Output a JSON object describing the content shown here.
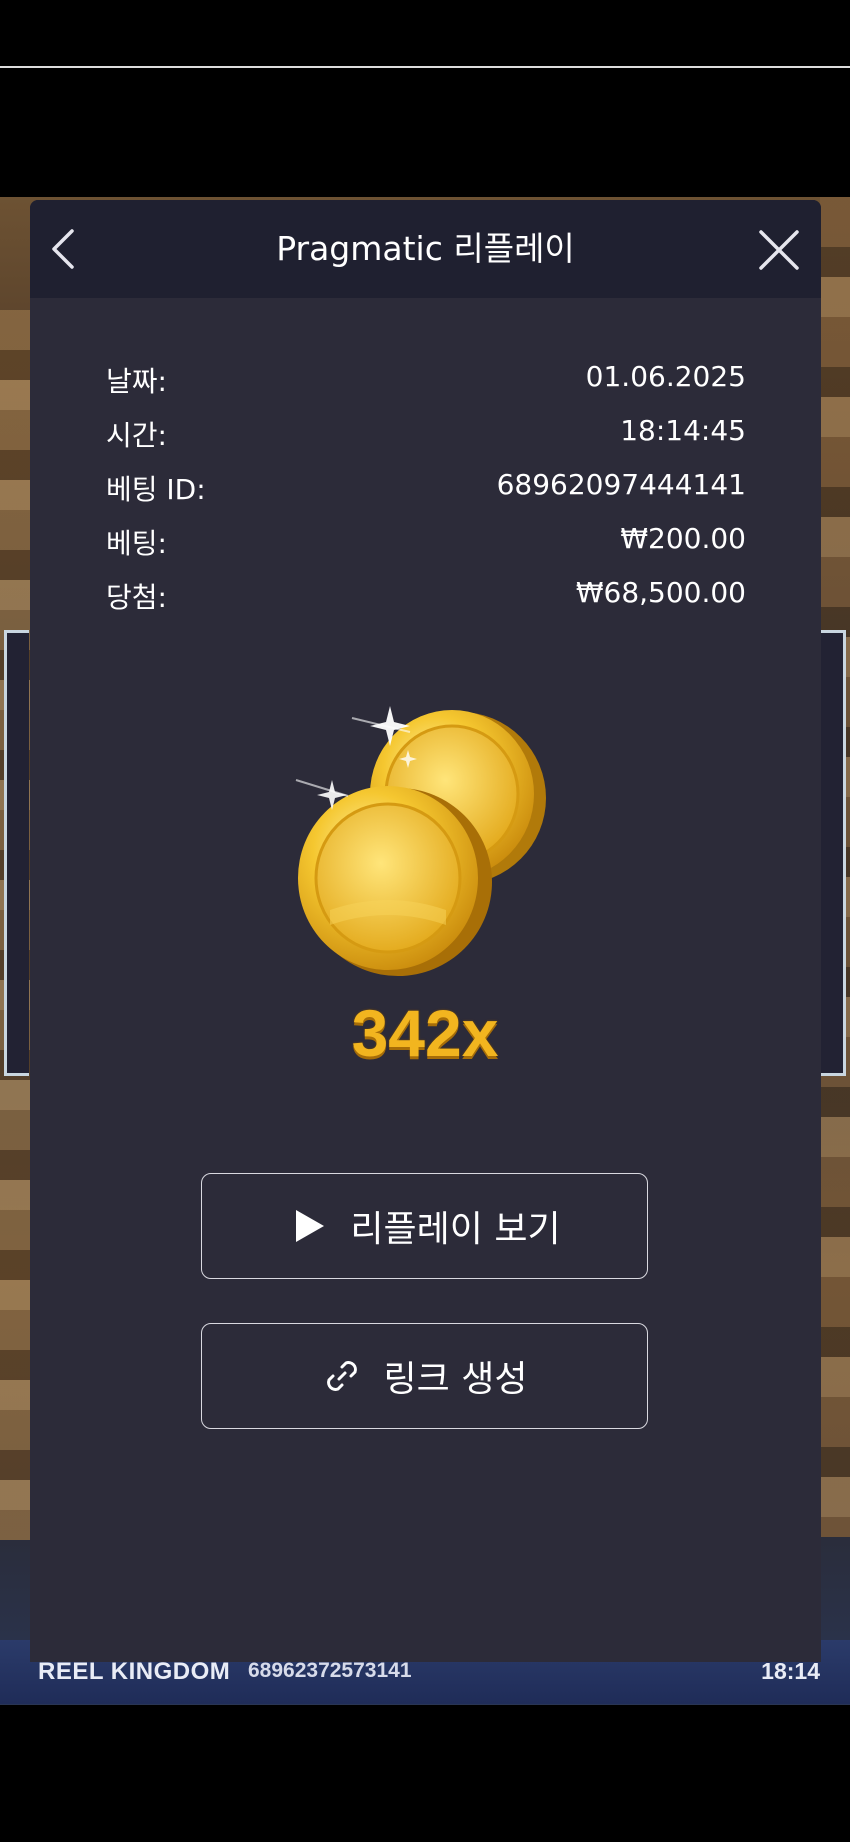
{
  "header": {
    "title": "Pragmatic 리플레이",
    "expand_glyph": "»"
  },
  "details": [
    {
      "label": "날짜:",
      "value": "01.06.2025"
    },
    {
      "label": "시간:",
      "value": "18:14:45"
    },
    {
      "label": "베팅 ID:",
      "value": "68962097444141"
    },
    {
      "label": "베팅:",
      "value": "₩200.00"
    },
    {
      "label": "당첨:",
      "value": "₩68,500.00"
    }
  ],
  "win": {
    "multiplier": "342x",
    "icon": "gold-coins-icon"
  },
  "actions": {
    "replay_label": "리플레이 보기",
    "link_label": "링크 생성"
  },
  "ticker": {
    "brand": "REEL KINGDOM",
    "bet_id": "68962372573141",
    "time": "18:14"
  },
  "colors": {
    "modal_bg": "#2c2b39",
    "header_bg": "#1f2030",
    "multiplier": "#f2b51f"
  }
}
